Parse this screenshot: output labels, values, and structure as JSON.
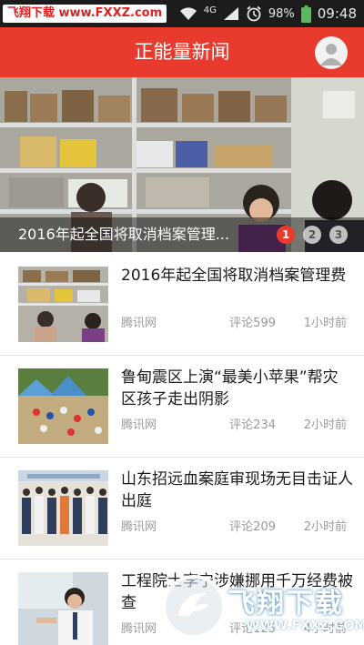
{
  "status_bar": {
    "watermark": "飞翔下载 www.FXXZ.com",
    "network": "4G",
    "battery": "98%",
    "time": "09:48"
  },
  "header": {
    "title": "正能量新闻"
  },
  "carousel": {
    "caption": "2016年起全国将取消档案管理...",
    "dots": [
      "1",
      "2",
      "3"
    ],
    "active_index": 0
  },
  "news": [
    {
      "title": "2016年起全国将取消档案管理费",
      "source": "腾讯网",
      "comments": "评论599",
      "time": "1小时前"
    },
    {
      "title": "鲁甸震区上演“最美小苹果”帮灾区孩子走出阴影",
      "source": "腾讯网",
      "comments": "评论234",
      "time": "2小时前"
    },
    {
      "title": "山东招远血案庭审现场无目击证人出庭",
      "source": "腾讯网",
      "comments": "评论209",
      "time": "2小时前"
    },
    {
      "title": "工程院士李宁涉嫌挪用千万经费被查",
      "source": "腾讯网",
      "comments": "评论125",
      "time": "4小时前"
    }
  ],
  "watermark_bottom": {
    "text": "飞翔下载",
    "url": "WWW.FXXZ.COM"
  },
  "colors": {
    "accent": "#e83b2e",
    "status_bar": "#1c1c1c",
    "meta_text": "#9a9a9a"
  }
}
